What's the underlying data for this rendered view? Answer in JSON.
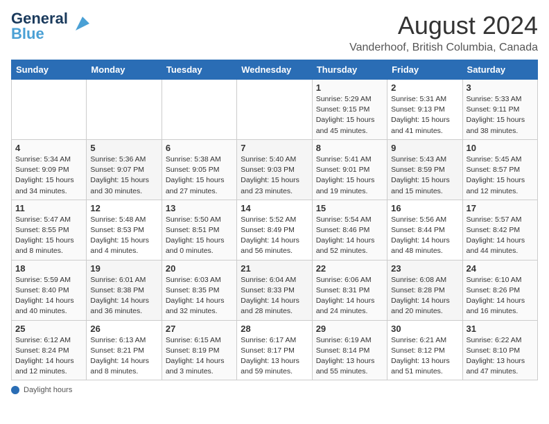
{
  "header": {
    "logo_line1": "General",
    "logo_line2": "Blue",
    "title": "August 2024",
    "subtitle": "Vanderhoof, British Columbia, Canada"
  },
  "days_of_week": [
    "Sunday",
    "Monday",
    "Tuesday",
    "Wednesday",
    "Thursday",
    "Friday",
    "Saturday"
  ],
  "weeks": [
    {
      "cells": [
        {
          "day": "",
          "info": ""
        },
        {
          "day": "",
          "info": ""
        },
        {
          "day": "",
          "info": ""
        },
        {
          "day": "",
          "info": ""
        },
        {
          "day": "1",
          "info": "Sunrise: 5:29 AM\nSunset: 9:15 PM\nDaylight: 15 hours\nand 45 minutes."
        },
        {
          "day": "2",
          "info": "Sunrise: 5:31 AM\nSunset: 9:13 PM\nDaylight: 15 hours\nand 41 minutes."
        },
        {
          "day": "3",
          "info": "Sunrise: 5:33 AM\nSunset: 9:11 PM\nDaylight: 15 hours\nand 38 minutes."
        }
      ]
    },
    {
      "cells": [
        {
          "day": "4",
          "info": "Sunrise: 5:34 AM\nSunset: 9:09 PM\nDaylight: 15 hours\nand 34 minutes."
        },
        {
          "day": "5",
          "info": "Sunrise: 5:36 AM\nSunset: 9:07 PM\nDaylight: 15 hours\nand 30 minutes."
        },
        {
          "day": "6",
          "info": "Sunrise: 5:38 AM\nSunset: 9:05 PM\nDaylight: 15 hours\nand 27 minutes."
        },
        {
          "day": "7",
          "info": "Sunrise: 5:40 AM\nSunset: 9:03 PM\nDaylight: 15 hours\nand 23 minutes."
        },
        {
          "day": "8",
          "info": "Sunrise: 5:41 AM\nSunset: 9:01 PM\nDaylight: 15 hours\nand 19 minutes."
        },
        {
          "day": "9",
          "info": "Sunrise: 5:43 AM\nSunset: 8:59 PM\nDaylight: 15 hours\nand 15 minutes."
        },
        {
          "day": "10",
          "info": "Sunrise: 5:45 AM\nSunset: 8:57 PM\nDaylight: 15 hours\nand 12 minutes."
        }
      ]
    },
    {
      "cells": [
        {
          "day": "11",
          "info": "Sunrise: 5:47 AM\nSunset: 8:55 PM\nDaylight: 15 hours\nand 8 minutes."
        },
        {
          "day": "12",
          "info": "Sunrise: 5:48 AM\nSunset: 8:53 PM\nDaylight: 15 hours\nand 4 minutes."
        },
        {
          "day": "13",
          "info": "Sunrise: 5:50 AM\nSunset: 8:51 PM\nDaylight: 15 hours\nand 0 minutes."
        },
        {
          "day": "14",
          "info": "Sunrise: 5:52 AM\nSunset: 8:49 PM\nDaylight: 14 hours\nand 56 minutes."
        },
        {
          "day": "15",
          "info": "Sunrise: 5:54 AM\nSunset: 8:46 PM\nDaylight: 14 hours\nand 52 minutes."
        },
        {
          "day": "16",
          "info": "Sunrise: 5:56 AM\nSunset: 8:44 PM\nDaylight: 14 hours\nand 48 minutes."
        },
        {
          "day": "17",
          "info": "Sunrise: 5:57 AM\nSunset: 8:42 PM\nDaylight: 14 hours\nand 44 minutes."
        }
      ]
    },
    {
      "cells": [
        {
          "day": "18",
          "info": "Sunrise: 5:59 AM\nSunset: 8:40 PM\nDaylight: 14 hours\nand 40 minutes."
        },
        {
          "day": "19",
          "info": "Sunrise: 6:01 AM\nSunset: 8:38 PM\nDaylight: 14 hours\nand 36 minutes."
        },
        {
          "day": "20",
          "info": "Sunrise: 6:03 AM\nSunset: 8:35 PM\nDaylight: 14 hours\nand 32 minutes."
        },
        {
          "day": "21",
          "info": "Sunrise: 6:04 AM\nSunset: 8:33 PM\nDaylight: 14 hours\nand 28 minutes."
        },
        {
          "day": "22",
          "info": "Sunrise: 6:06 AM\nSunset: 8:31 PM\nDaylight: 14 hours\nand 24 minutes."
        },
        {
          "day": "23",
          "info": "Sunrise: 6:08 AM\nSunset: 8:28 PM\nDaylight: 14 hours\nand 20 minutes."
        },
        {
          "day": "24",
          "info": "Sunrise: 6:10 AM\nSunset: 8:26 PM\nDaylight: 14 hours\nand 16 minutes."
        }
      ]
    },
    {
      "cells": [
        {
          "day": "25",
          "info": "Sunrise: 6:12 AM\nSunset: 8:24 PM\nDaylight: 14 hours\nand 12 minutes."
        },
        {
          "day": "26",
          "info": "Sunrise: 6:13 AM\nSunset: 8:21 PM\nDaylight: 14 hours\nand 8 minutes."
        },
        {
          "day": "27",
          "info": "Sunrise: 6:15 AM\nSunset: 8:19 PM\nDaylight: 14 hours\nand 3 minutes."
        },
        {
          "day": "28",
          "info": "Sunrise: 6:17 AM\nSunset: 8:17 PM\nDaylight: 13 hours\nand 59 minutes."
        },
        {
          "day": "29",
          "info": "Sunrise: 6:19 AM\nSunset: 8:14 PM\nDaylight: 13 hours\nand 55 minutes."
        },
        {
          "day": "30",
          "info": "Sunrise: 6:21 AM\nSunset: 8:12 PM\nDaylight: 13 hours\nand 51 minutes."
        },
        {
          "day": "31",
          "info": "Sunrise: 6:22 AM\nSunset: 8:10 PM\nDaylight: 13 hours\nand 47 minutes."
        }
      ]
    }
  ],
  "footer": {
    "daylight_label": "Daylight hours"
  }
}
